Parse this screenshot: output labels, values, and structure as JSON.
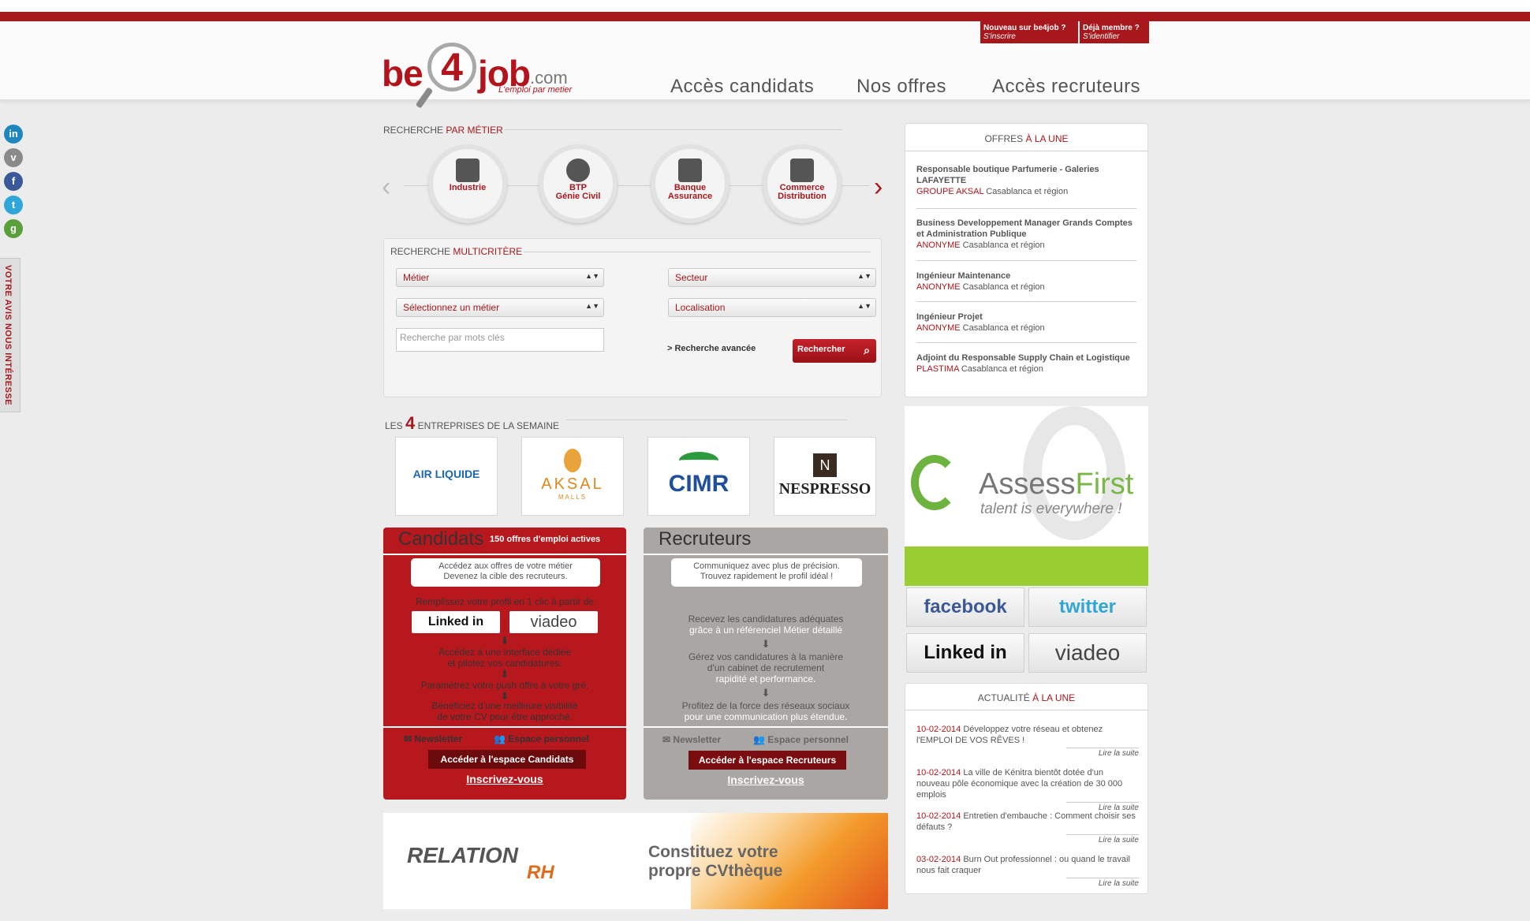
{
  "header": {
    "signup": {
      "line1": "Nouveau sur be4job ?",
      "line2": "S'inscrire"
    },
    "login": {
      "line1": "Déjà membre ?",
      "line2": "S'identifier"
    },
    "logo": {
      "be": "be",
      "four": "4",
      "job": "job",
      "com": ".com",
      "tagline": "L'emploi par metier"
    },
    "nav": [
      "Accès candidats",
      "Nos offres",
      "Accès recruteurs"
    ]
  },
  "sidebar": {
    "social_icons": [
      "linkedin-icon",
      "viadeo-icon",
      "facebook-icon",
      "twitter-icon",
      "google-plus-icon"
    ],
    "feedback": "VOTRE AVIS NOUS INTÉRESSE"
  },
  "metier_search": {
    "title_a": "RECHERCHE ",
    "title_b": "PAR MÉTIER",
    "items": [
      {
        "line1": "Industrie",
        "line2": ""
      },
      {
        "line1": "BTP",
        "line2": "Génie Civil"
      },
      {
        "line1": "Banque",
        "line2": "Assurance"
      },
      {
        "line1": "Commerce",
        "line2": "Distribution"
      }
    ]
  },
  "multi_search": {
    "title_a": "RECHERCHE ",
    "title_b": "MULTICRITÈRE",
    "metier": "Métier",
    "secteur": "Secteur",
    "select_metier": "Sélectionnez un métier",
    "localisation": "Localisation",
    "keywords_placeholder": "Recherche par mots clés",
    "advanced": "> Recherche avancée",
    "search_button": "Rechercher"
  },
  "companies": {
    "title_a": "LES ",
    "title_num": "4",
    "title_b": " ENTREPRISES DE LA SEMAINE",
    "items": [
      "AIR LIQUIDE",
      "AKSAL",
      "CIMR",
      "NESPRESSO"
    ],
    "aksal_sub": "MALLS"
  },
  "candidats": {
    "title": "Candidats",
    "count": "150 offres d'emploi actives",
    "bubble_1": "Accédez aux offres de votre métier",
    "bubble_2": "Devenez la cible des recruteurs.",
    "profile_line": "Remplissez votre profil en 1 clic à partir de",
    "linkedin": "Linked in",
    "viadeo": "viadeo",
    "step1_a": "Accédez à une interface dédiée",
    "step1_b": "et pilotez vos candidatures.",
    "step2": "Paramétrez votre push offre à votre gré.",
    "step3_a": "Bénéficiez d'une meilleure visibilité",
    "step3_b": "de votre CV pour être approché.",
    "newsletter": "Newsletter",
    "espace": "Espace personnel",
    "access_button": "Accéder à l'espace Candidats",
    "signup": "Inscrivez-vous"
  },
  "recruteurs": {
    "title": "Recruteurs",
    "bubble_1": "Communiquez avec plus de précision.",
    "bubble_2": "Trouvez rapidement le profil idéal !",
    "step1_a": "Recevez les candidatures adéquates",
    "step1_b": "grâce à un référenciel Métier détaillé",
    "step2_a": "Gérez vos candidatures à la manière",
    "step2_b": "d'un cabinet de recrutement",
    "step2_c": "rapidité et performance.",
    "step3_a": "Profitez de la force des réseaux sociaux",
    "step3_b": "pour une communication plus étendue.",
    "newsletter": "Newsletter",
    "espace": "Espace personnel",
    "access_button": "Accéder à l'espace Recruteurs",
    "signup": "Inscrivez-vous"
  },
  "banner": {
    "brand_a": "RELATION",
    "brand_b": "RH",
    "text_1": "Constituez votre",
    "text_2": "propre CVthèque"
  },
  "offres": {
    "title_a": "OFFRES ",
    "title_b": "À LA UNE",
    "items": [
      {
        "title": "Responsable boutique Parfumerie - Galeries LAFAYETTE",
        "company": "GROUPE AKSAL",
        "location": " Casablanca et région"
      },
      {
        "title": "Business Developpement Manager Grands Comptes et Administration Publique",
        "company": "ANONYME",
        "location": " Casablanca et région"
      },
      {
        "title": "Ingénieur Maintenance",
        "company": "ANONYME",
        "location": " Casablanca et région"
      },
      {
        "title": "Ingénieur Projet",
        "company": "ANONYME",
        "location": " Casablanca et région"
      },
      {
        "title": "Adjoint du Responsable Supply Chain et Logistique",
        "company": "PLASTIMA",
        "location": " Casablanca et région"
      }
    ]
  },
  "assessfirst": {
    "brand_a": "Assess",
    "brand_b": "First",
    "tagline": "talent is everywhere !"
  },
  "social_buttons": [
    "facebook",
    "twitter",
    "Linked in",
    "viadeo"
  ],
  "actualite": {
    "title_a": "ACTUALITÉ ",
    "title_b": "À LA UNE",
    "items": [
      {
        "date": "10-02-2014",
        "text": " Développez votre réseau et obtenez l'EMPLOI DE VOS RÊVES !",
        "more": "Lire la suite"
      },
      {
        "date": "10-02-2014",
        "text": " La ville de Kénitra bientôt dotée d'un nouveau pôle économique avec la création de 30 000 emplois",
        "more": "Lire la suite"
      },
      {
        "date": "10-02-2014",
        "text": " Entretien d'embauche : Comment choisir ses défauts ?",
        "more": "Lire la suite"
      },
      {
        "date": "03-02-2014",
        "text": " Burn Out professionnel : ou quand le travail nous fait craquer",
        "more": "Lire la suite"
      }
    ]
  },
  "colors": {
    "brand_red": "#a8171c",
    "recruteur_gray": "#a9a6a4",
    "assessfirst_green": "#9acd32"
  }
}
